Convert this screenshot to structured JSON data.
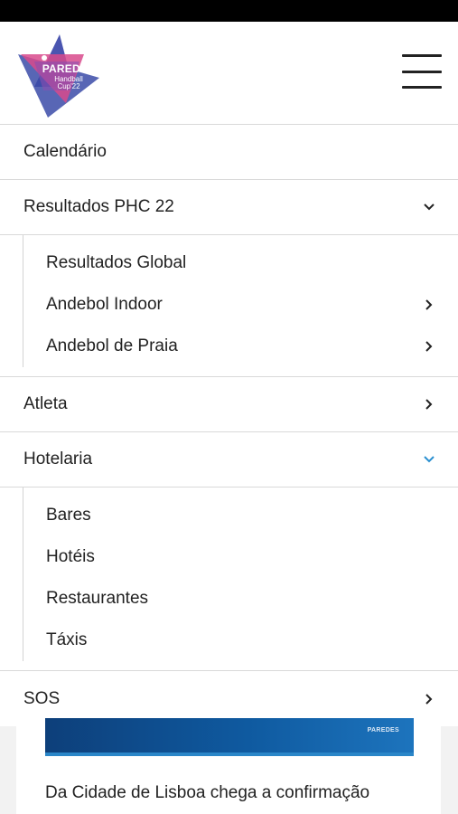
{
  "logo": {
    "line1": "PAREDES",
    "line2": "Handball",
    "line3": "Cup'22"
  },
  "colors": {
    "accent_chevron": "#2a8fd0",
    "logo_blue": "#3b4ba8",
    "logo_pink": "#d84a8c",
    "banner_blue": "#0f5aa0"
  },
  "nav": {
    "calendario": "Calendário",
    "resultados": {
      "label": "Resultados PHC 22",
      "children": [
        "Resultados Global",
        "Andebol Indoor",
        "Andebol de Praia"
      ]
    },
    "atleta": "Atleta",
    "hotelaria": {
      "label": "Hotelaria",
      "children": [
        "Bares",
        "Hotéis",
        "Restaurantes",
        "Táxis"
      ]
    },
    "sos": "SOS"
  },
  "article": {
    "banner_logo": "PAREDES",
    "text": "Da Cidade de Lisboa chega a confirmação"
  },
  "icons": {
    "menu": "hamburger-icon",
    "expand": "chevron-down-icon",
    "next": "chevron-right-icon"
  }
}
